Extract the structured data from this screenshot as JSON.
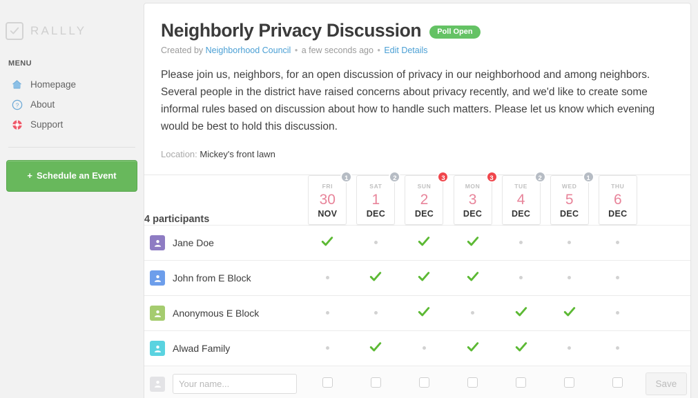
{
  "sidebar": {
    "brand": "RALLLY",
    "menu_label": "MENU",
    "items": [
      {
        "label": "Homepage",
        "icon": "home-icon"
      },
      {
        "label": "About",
        "icon": "question-circle-icon"
      },
      {
        "label": "Support",
        "icon": "lifebuoy-icon"
      }
    ],
    "schedule_button": {
      "plus": "+",
      "label": "Schedule an Event"
    }
  },
  "poll": {
    "title": "Neighborly Privacy Discussion",
    "status_badge": "Poll Open",
    "created_prefix": "Created by",
    "author": "Neighborhood Council",
    "sep": "•",
    "created_time": "a few seconds ago",
    "edit_link": "Edit Details",
    "description": "Please join us, neighbors, for an open discussion of privacy in our neighborhood and among neighbors. Several people in the district have raised concerns about privacy recently, and we'd like to create some informal rules based on discussion about how to handle such matters. Please let us know which evening would be best to hold this discussion.",
    "location_label": "Location:",
    "location_value": "Mickey's front lawn"
  },
  "table": {
    "participants_count_label": "4 participants",
    "name_placeholder": "Your name...",
    "save_label": "Save",
    "dates": [
      {
        "dow": "FRI",
        "day": "30",
        "month": "NOV",
        "count": "1",
        "badge_color": "grey"
      },
      {
        "dow": "SAT",
        "day": "1",
        "month": "DEC",
        "count": "2",
        "badge_color": "grey"
      },
      {
        "dow": "SUN",
        "day": "2",
        "month": "DEC",
        "count": "3",
        "badge_color": "red"
      },
      {
        "dow": "MON",
        "day": "3",
        "month": "DEC",
        "count": "3",
        "badge_color": "red"
      },
      {
        "dow": "TUE",
        "day": "4",
        "month": "DEC",
        "count": "2",
        "badge_color": "grey"
      },
      {
        "dow": "WED",
        "day": "5",
        "month": "DEC",
        "count": "1",
        "badge_color": "grey"
      },
      {
        "dow": "THU",
        "day": "6",
        "month": "DEC",
        "count": "",
        "badge_color": "none"
      }
    ],
    "participants": [
      {
        "name": "Jane Doe",
        "avatar_color": "#8e7cc3",
        "votes": [
          true,
          false,
          true,
          true,
          false,
          false,
          false
        ]
      },
      {
        "name": "John from E Block",
        "avatar_color": "#6d9eeb",
        "votes": [
          false,
          true,
          true,
          true,
          false,
          false,
          false
        ]
      },
      {
        "name": "Anonymous E Block",
        "avatar_color": "#a5cc6f",
        "votes": [
          false,
          false,
          true,
          false,
          true,
          true,
          false
        ]
      },
      {
        "name": "Alwad Family",
        "avatar_color": "#5ad3e0",
        "votes": [
          false,
          true,
          false,
          true,
          true,
          false,
          false
        ]
      }
    ]
  },
  "colors": {
    "check_green": "#5cb934",
    "accent_green": "#68b85c",
    "badge_red": "#f0464c",
    "badge_grey": "#b6bcc4",
    "date_pink": "#e8849a",
    "link_blue": "#4a9fd4"
  }
}
